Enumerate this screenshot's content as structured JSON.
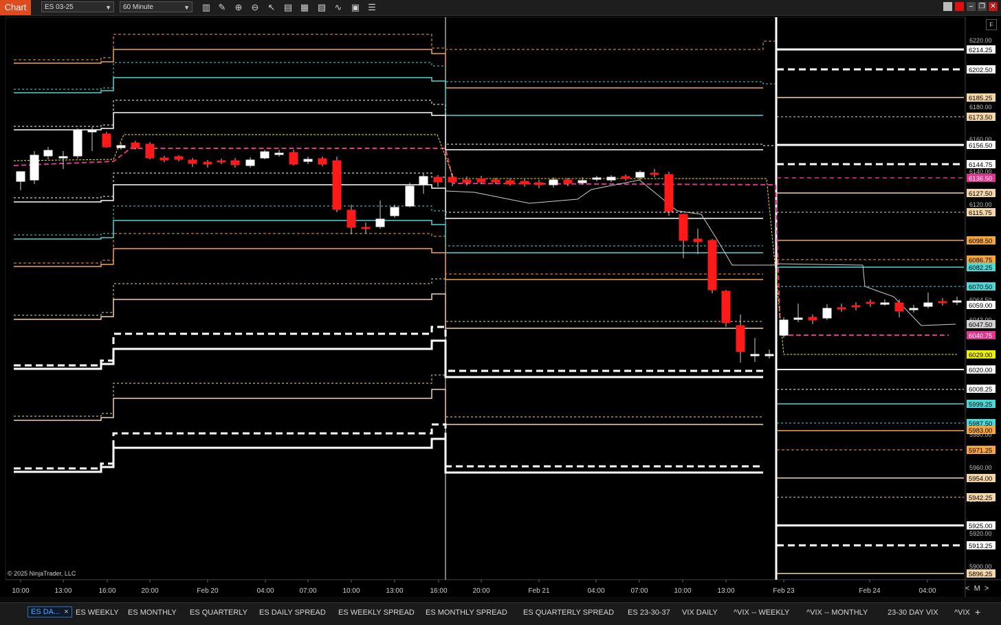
{
  "window": {
    "title": "Chart",
    "instrument": "ES 03-25",
    "interval": "60 Minute"
  },
  "toolbar_icons": [
    "bar-type-icon",
    "drawing-tool-icon",
    "zoom-in-icon",
    "zoom-out-icon",
    "pointer-icon",
    "data-box-icon",
    "chart-properties-icon",
    "indicators-icon",
    "strategies-icon",
    "templates-icon"
  ],
  "copyright": "© 2025 NinjaTrader, LLC",
  "nav": {
    "prev": "<",
    "mode": "M",
    "next": ">"
  },
  "f_button": "F",
  "time_axis": [
    "10:00",
    "13:00",
    "16:00",
    "20:00",
    "Feb 20",
    "04:00",
    "07:00",
    "10:00",
    "13:00",
    "16:00",
    "20:00",
    "Feb 21",
    "04:00",
    "07:00",
    "10:00",
    "13:00",
    "Feb 23",
    "Feb 24",
    "04:00"
  ],
  "price_axis_ticks": [
    "6220.00",
    "6180.00",
    "6160.00",
    "6140.00",
    "6120.00",
    "6064.50",
    "6043.00",
    "5980.00",
    "5960.00",
    "5940.00",
    "5920.00",
    "5900.00"
  ],
  "price_labels": [
    {
      "text": "6214.25",
      "color": "#000000",
      "bg": "#ffffff"
    },
    {
      "text": "6202.50",
      "color": "#000000",
      "bg": "#ffffff"
    },
    {
      "text": "6185.25",
      "color": "#000000",
      "bg": "#f5d6a8"
    },
    {
      "text": "6173.50",
      "color": "#000000",
      "bg": "#f5d6a8"
    },
    {
      "text": "6156.50",
      "color": "#000000",
      "bg": "#ffffff"
    },
    {
      "text": "6144.75",
      "color": "#000000",
      "bg": "#ffffff"
    },
    {
      "text": "6136.50",
      "color": "#ffffff",
      "bg": "#e0358f"
    },
    {
      "text": "6127.50",
      "color": "#000000",
      "bg": "#f5d6a8"
    },
    {
      "text": "6115.75",
      "color": "#000000",
      "bg": "#f5d6a8"
    },
    {
      "text": "6098.50",
      "color": "#000000",
      "bg": "#f5a542"
    },
    {
      "text": "6086.75",
      "color": "#000000",
      "bg": "#f5a542"
    },
    {
      "text": "6082.25",
      "color": "#000000",
      "bg": "#4fd6d6"
    },
    {
      "text": "6070.50",
      "color": "#000000",
      "bg": "#4fd6d6"
    },
    {
      "text": "6059.00",
      "color": "#000000",
      "bg": "#ffffff"
    },
    {
      "text": "6047.50",
      "color": "#000000",
      "bg": "#d0d0d0"
    },
    {
      "text": "6040.75",
      "color": "#ffffff",
      "bg": "#e0358f"
    },
    {
      "text": "6029.00",
      "color": "#000000",
      "bg": "#f0f000"
    },
    {
      "text": "6020.00",
      "color": "#000000",
      "bg": "#ffffff"
    },
    {
      "text": "6008.25",
      "color": "#000000",
      "bg": "#ffffff"
    },
    {
      "text": "5999.25",
      "color": "#000000",
      "bg": "#4fd6d6"
    },
    {
      "text": "5987.50",
      "color": "#000000",
      "bg": "#4fd6d6"
    },
    {
      "text": "5983.00",
      "color": "#000000",
      "bg": "#f5a542"
    },
    {
      "text": "5971.25",
      "color": "#000000",
      "bg": "#f5a542"
    },
    {
      "text": "5954.00",
      "color": "#000000",
      "bg": "#f5d6a8"
    },
    {
      "text": "5942.25",
      "color": "#000000",
      "bg": "#f5d6a8"
    },
    {
      "text": "5925.00",
      "color": "#000000",
      "bg": "#ffffff"
    },
    {
      "text": "5913.25",
      "color": "#000000",
      "bg": "#ffffff"
    },
    {
      "text": "5896.25",
      "color": "#000000",
      "bg": "#f5d6a8"
    }
  ],
  "tabs": [
    {
      "label": "ES DA...",
      "active": true
    },
    {
      "label": "ES WEEKLY"
    },
    {
      "label": "ES MONTHLY"
    },
    {
      "label": "ES QUARTERLY"
    },
    {
      "label": "ES DAILY SPREAD"
    },
    {
      "label": "ES WEEKLY SPREAD"
    },
    {
      "label": "ES MONTHLY SPREAD"
    },
    {
      "label": "ES QUARTERLY SPREAD"
    },
    {
      "label": "ES 23-30-37"
    },
    {
      "label": "VIX DAILY"
    },
    {
      "label": "^VIX -- WEEKLY"
    },
    {
      "label": "^VIX -- MONTHLY"
    },
    {
      "label": "23-30 DAY VIX"
    },
    {
      "label": "^VIX"
    }
  ],
  "tab_close": "×",
  "tab_add": "+",
  "colors": {
    "bull": "#ffffff",
    "bear": "#ff1a1a",
    "white_level": "#ffffff",
    "orange": "#f5a542",
    "cyan": "#4fd6d6",
    "tan": "#f5d6a8",
    "magenta": "#e0358f",
    "yellow": "#f0f000",
    "accent": "#e04a1f"
  }
}
